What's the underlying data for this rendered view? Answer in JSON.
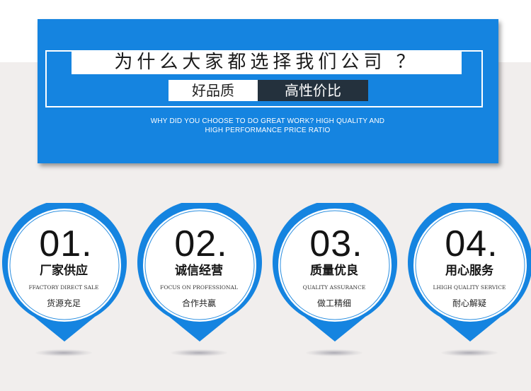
{
  "banner": {
    "title": "为什么大家都选择我们公司 ？",
    "tag_left": "好品质",
    "tag_right": "高性价比",
    "subtitle_line1": "WHY DID YOU CHOOSE TO DO GREAT WORK? HIGH QUALITY AND",
    "subtitle_line2": "HIGH PERFORMANCE PRICE RATIO"
  },
  "colors": {
    "accent_blue": "#1584e0",
    "dark_tag": "#24313d",
    "page_background": "#f1eeed"
  },
  "features": [
    {
      "number": "01.",
      "title": "厂家供应",
      "subtitle_en": "FFACTORY DIRECT SALE",
      "subtitle_cn": "货源充足"
    },
    {
      "number": "02.",
      "title": "诚信经营",
      "subtitle_en": "FOCUS ON PROFESSIONAL",
      "subtitle_cn": "合作共赢"
    },
    {
      "number": "03.",
      "title": "质量优良",
      "subtitle_en": "QUALITY ASSURANCE",
      "subtitle_cn": "做工精细"
    },
    {
      "number": "04.",
      "title": "用心服务",
      "subtitle_en": "LHIGH QUALITY SERVICE",
      "subtitle_cn": "耐心解疑"
    }
  ]
}
